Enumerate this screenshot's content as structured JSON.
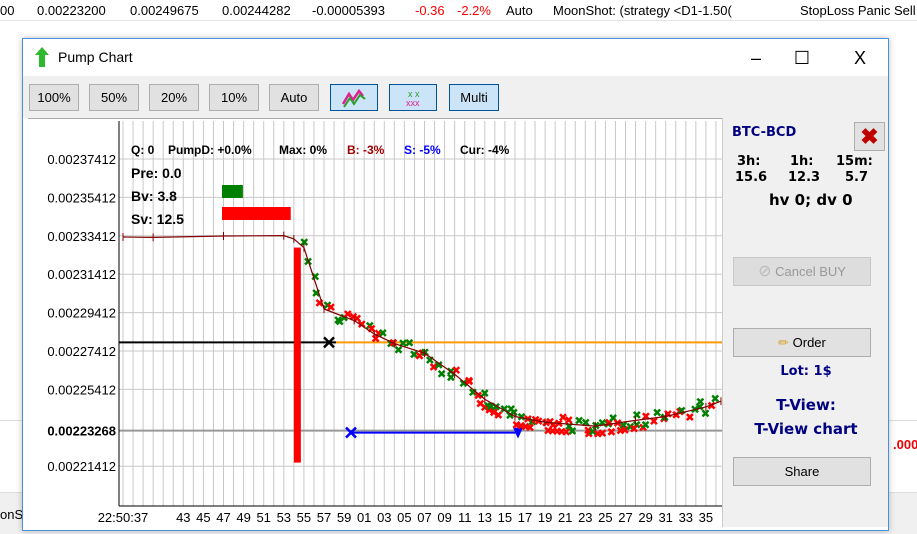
{
  "background_row": {
    "cells": [
      "00",
      "0.00223200",
      "0.00249675",
      "0.00244282",
      "-0.00005393",
      "-0.36",
      "-2.2%",
      "Auto",
      "MoonShot: (strategy <D1-1.50(",
      "StopLoss Panic Sell"
    ]
  },
  "background_bottom": {
    "left": "onS",
    "right_red": ".000"
  },
  "window": {
    "title": "Pump Chart",
    "minimize": "–",
    "maximize": "☐",
    "close": "X"
  },
  "toolbar": {
    "buttons": [
      {
        "label": "100%"
      },
      {
        "label": "50%"
      },
      {
        "label": "20%"
      },
      {
        "label": "10%"
      },
      {
        "label": "Auto"
      },
      {
        "label": "",
        "icon": "line-chart-icon",
        "selected": true
      },
      {
        "label": "",
        "icon": "scatter-chart-icon",
        "selected": true
      },
      {
        "label": "Multi",
        "selected": true
      }
    ]
  },
  "chart": {
    "header": {
      "q": "Q: 0",
      "pumpd": "PumpD: +0.0%",
      "max": "Max: 0%",
      "b": "B: -3%",
      "s": "S: -5%",
      "cur": "Cur: -4%"
    },
    "pre": "Pre: 0.0",
    "bv": "Bv: 3.8",
    "sv": "Sv: 12.5",
    "bv_value": 3.8,
    "sv_value": 12.5,
    "y_labels": [
      "0.00237412",
      "0.00235412",
      "0.00233412",
      "0.00231412",
      "0.00229412",
      "0.00227412",
      "0.00225412",
      "0.00223268",
      "0.00221412"
    ],
    "x_labels": [
      "22:50:37",
      "43",
      "45",
      "47",
      "49",
      "51",
      "53",
      "55",
      "57",
      "59",
      "01",
      "03",
      "05",
      "07",
      "09",
      "11",
      "13",
      "15",
      "17",
      "19",
      "21",
      "23",
      "25",
      "27",
      "29",
      "31",
      "33",
      "35"
    ],
    "current_price": 0.00223268,
    "buy_line": 0.0022786,
    "colors": {
      "buy": "#008000",
      "sell": "#ff0000",
      "price": "#800000",
      "target": "#ff9900",
      "stop": "#0000ff"
    }
  },
  "chart_data": {
    "type": "line",
    "x_unit": "seconds after 22:50:37",
    "series": [
      {
        "x": [
          0,
          3,
          10,
          16,
          17,
          18,
          20,
          23,
          25,
          27,
          30,
          33,
          36,
          39,
          42,
          47,
          51,
          54,
          58,
          59.5
        ],
        "y": [
          0.0023335,
          0.0023333,
          0.002334,
          0.0023342,
          0.0023325,
          0.002328,
          0.002296,
          0.00229,
          0.002283,
          0.002278,
          0.002273,
          0.002262,
          0.002249,
          0.00224,
          0.002237,
          0.002235,
          0.002238,
          0.00224,
          0.002245,
          0.002248
        ]
      }
    ]
  },
  "side": {
    "pair": "BTC-BCD",
    "h3_label": "3h:",
    "h1_label": "1h:",
    "m15_label": "15m:",
    "h3": "15.6",
    "h1": "12.3",
    "m15": "5.7",
    "hvdv": "hv 0; dv 0",
    "cancel_buy": "Cancel BUY",
    "order": "Order",
    "lot": "Lot: 1$",
    "tview": "T-View:",
    "tview_chart": "T-View chart",
    "share": "Share"
  }
}
